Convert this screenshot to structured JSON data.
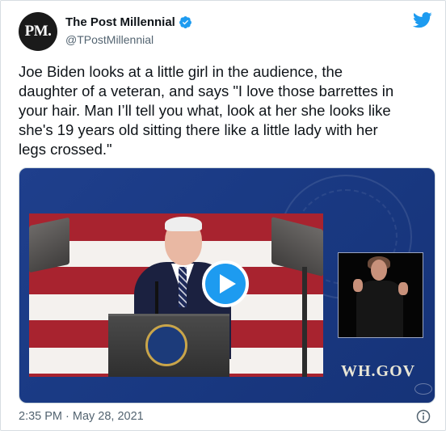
{
  "tweet": {
    "avatar_text": "PM.",
    "display_name": "The Post Millennial",
    "handle": "@TPostMillennial",
    "verified": true,
    "text": "Joe Biden looks at a little girl in the audience, the\ndaughter of a veteran, and says \"I love those barrettes in\nyour hair. Man I’ll tell you what, look at her she looks like\nshe's 19 years old sitting there like a little lady with her\nlegs crossed.\"",
    "timestamp": "2:35 PM · May 28, 2021"
  },
  "media": {
    "type": "video",
    "watermark": "WH.GOV",
    "play_icon": "play-icon"
  },
  "icons": {
    "brand": "twitter-bird-icon",
    "verified": "verified-badge-icon",
    "info": "info-icon"
  },
  "colors": {
    "accent": "#1d9bf0",
    "text": "#0f1419",
    "secondary_text": "#536471",
    "media_background": "#1f3f8c"
  }
}
